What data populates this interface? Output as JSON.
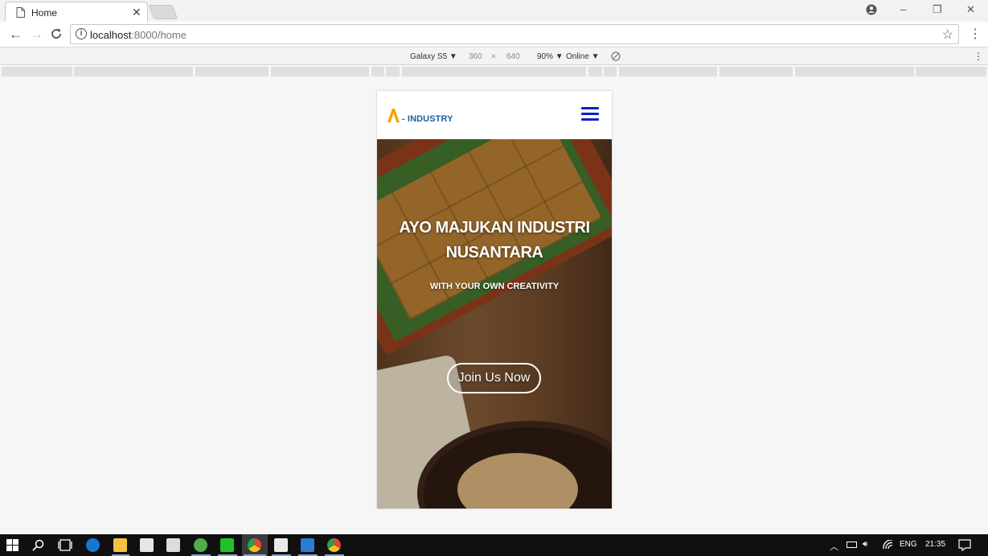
{
  "browser": {
    "tab_title": "Home",
    "tab_close": "✕",
    "url_host": "localhost",
    "url_path": ":8000/home",
    "win_controls": [
      "–",
      "❐",
      "✕"
    ]
  },
  "device_toolbar": {
    "device": "Galaxy S5 ▼",
    "width": "360",
    "times": "×",
    "height": "640",
    "zoom": "90% ▼",
    "network": "Online ▼"
  },
  "site": {
    "brand": "- INDUSTRY",
    "hero_title_line1": "AYO MAJUKAN INDUSTRI",
    "hero_title_line2": "NUSANTARA",
    "hero_subtitle": "WITH YOUR OWN CREATIVITY",
    "cta_label": "Join Us Now",
    "logo_color": "#f5a300",
    "brand_color": "#1a5f9e",
    "menu_color": "#0c20c8"
  },
  "taskbar": {
    "language": "ENG",
    "time": "21:35"
  }
}
